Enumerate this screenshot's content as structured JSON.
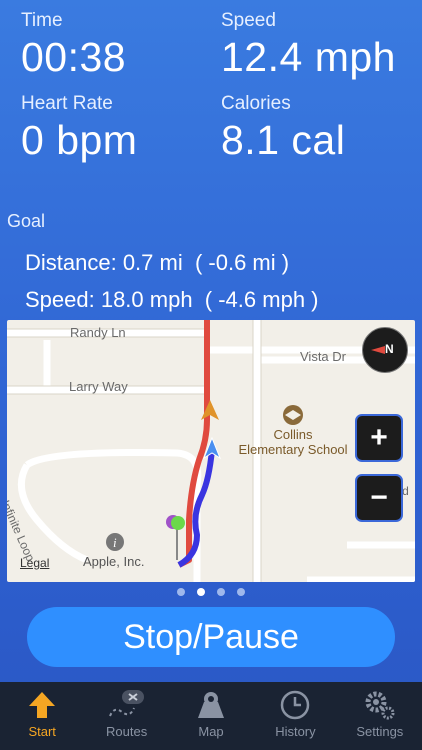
{
  "stats": {
    "time": {
      "label": "Time",
      "value": "00:38"
    },
    "speed": {
      "label": "Speed",
      "value": "12.4 mph"
    },
    "heart_rate": {
      "label": "Heart Rate",
      "value": "0 bpm"
    },
    "calories": {
      "label": "Calories",
      "value": "8.1 cal"
    }
  },
  "goal": {
    "label": "Goal",
    "distance": "Distance: 0.7 mi  ( -0.6 mi )",
    "speed": "Speed: 18.0 mph  ( -4.6 mph )"
  },
  "map": {
    "streets": {
      "randy": "Randy Ln",
      "vista": "Vista Dr",
      "larry": "Larry Way",
      "infinite": "Infinite Loop",
      "vagabond": "Vagabond Sv"
    },
    "poi_school": "Collins\nElementary School",
    "poi_apple": "Apple, Inc.",
    "legal": "Legal",
    "zoom_in": "+",
    "zoom_out": "−",
    "compass": "N",
    "colors": {
      "route_red": "#e04a3f",
      "route_blue": "#3a35e0"
    }
  },
  "pager": {
    "count": 4,
    "active": 1
  },
  "stop_button": "Stop/Pause",
  "tabs": [
    {
      "label": "Start",
      "icon": "arrow-up-icon"
    },
    {
      "label": "Routes",
      "icon": "route-icon"
    },
    {
      "label": "Map",
      "icon": "map-pin-icon"
    },
    {
      "label": "History",
      "icon": "clock-icon"
    },
    {
      "label": "Settings",
      "icon": "gear-icon"
    }
  ],
  "accent_color": "#f5a623"
}
